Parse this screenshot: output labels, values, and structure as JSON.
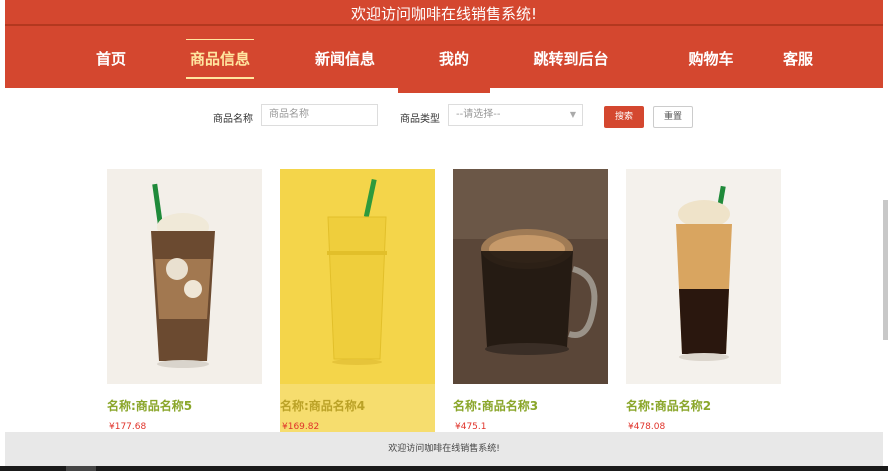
{
  "header": {
    "site_title": "欢迎访问咖啡在线销售系统!",
    "nav": [
      {
        "label": "首页"
      },
      {
        "label": "商品信息"
      },
      {
        "label": "新闻信息"
      },
      {
        "label": "我的"
      },
      {
        "label": "跳转到后台"
      },
      {
        "label": "购物车"
      },
      {
        "label": "客服"
      }
    ],
    "active_nav": "商品信息"
  },
  "search": {
    "name_label": "商品名称",
    "name_placeholder": "商品名称",
    "type_label": "商品类型",
    "type_selected": "--请选择--",
    "search_button": "搜索",
    "reset_button": "重置"
  },
  "products": [
    {
      "name": "名称:商品名称5",
      "price": "¥177.68",
      "image": "iced-coffee-float"
    },
    {
      "name": "名称:商品名称4",
      "price": "¥169.82",
      "image": "mango-smoothie"
    },
    {
      "name": "名称:商品名称3",
      "price": "¥475.1",
      "image": "espresso-glass-mug"
    },
    {
      "name": "名称:商品名称2",
      "price": "¥478.08",
      "image": "coffee-float"
    }
  ],
  "footer": {
    "text": "欢迎访问咖啡在线销售系统!"
  },
  "colors": {
    "brand_red": "#d4472f",
    "active_nav": "#ffe6a0",
    "product_name": "#8aa62a",
    "price": "#e0332a"
  }
}
